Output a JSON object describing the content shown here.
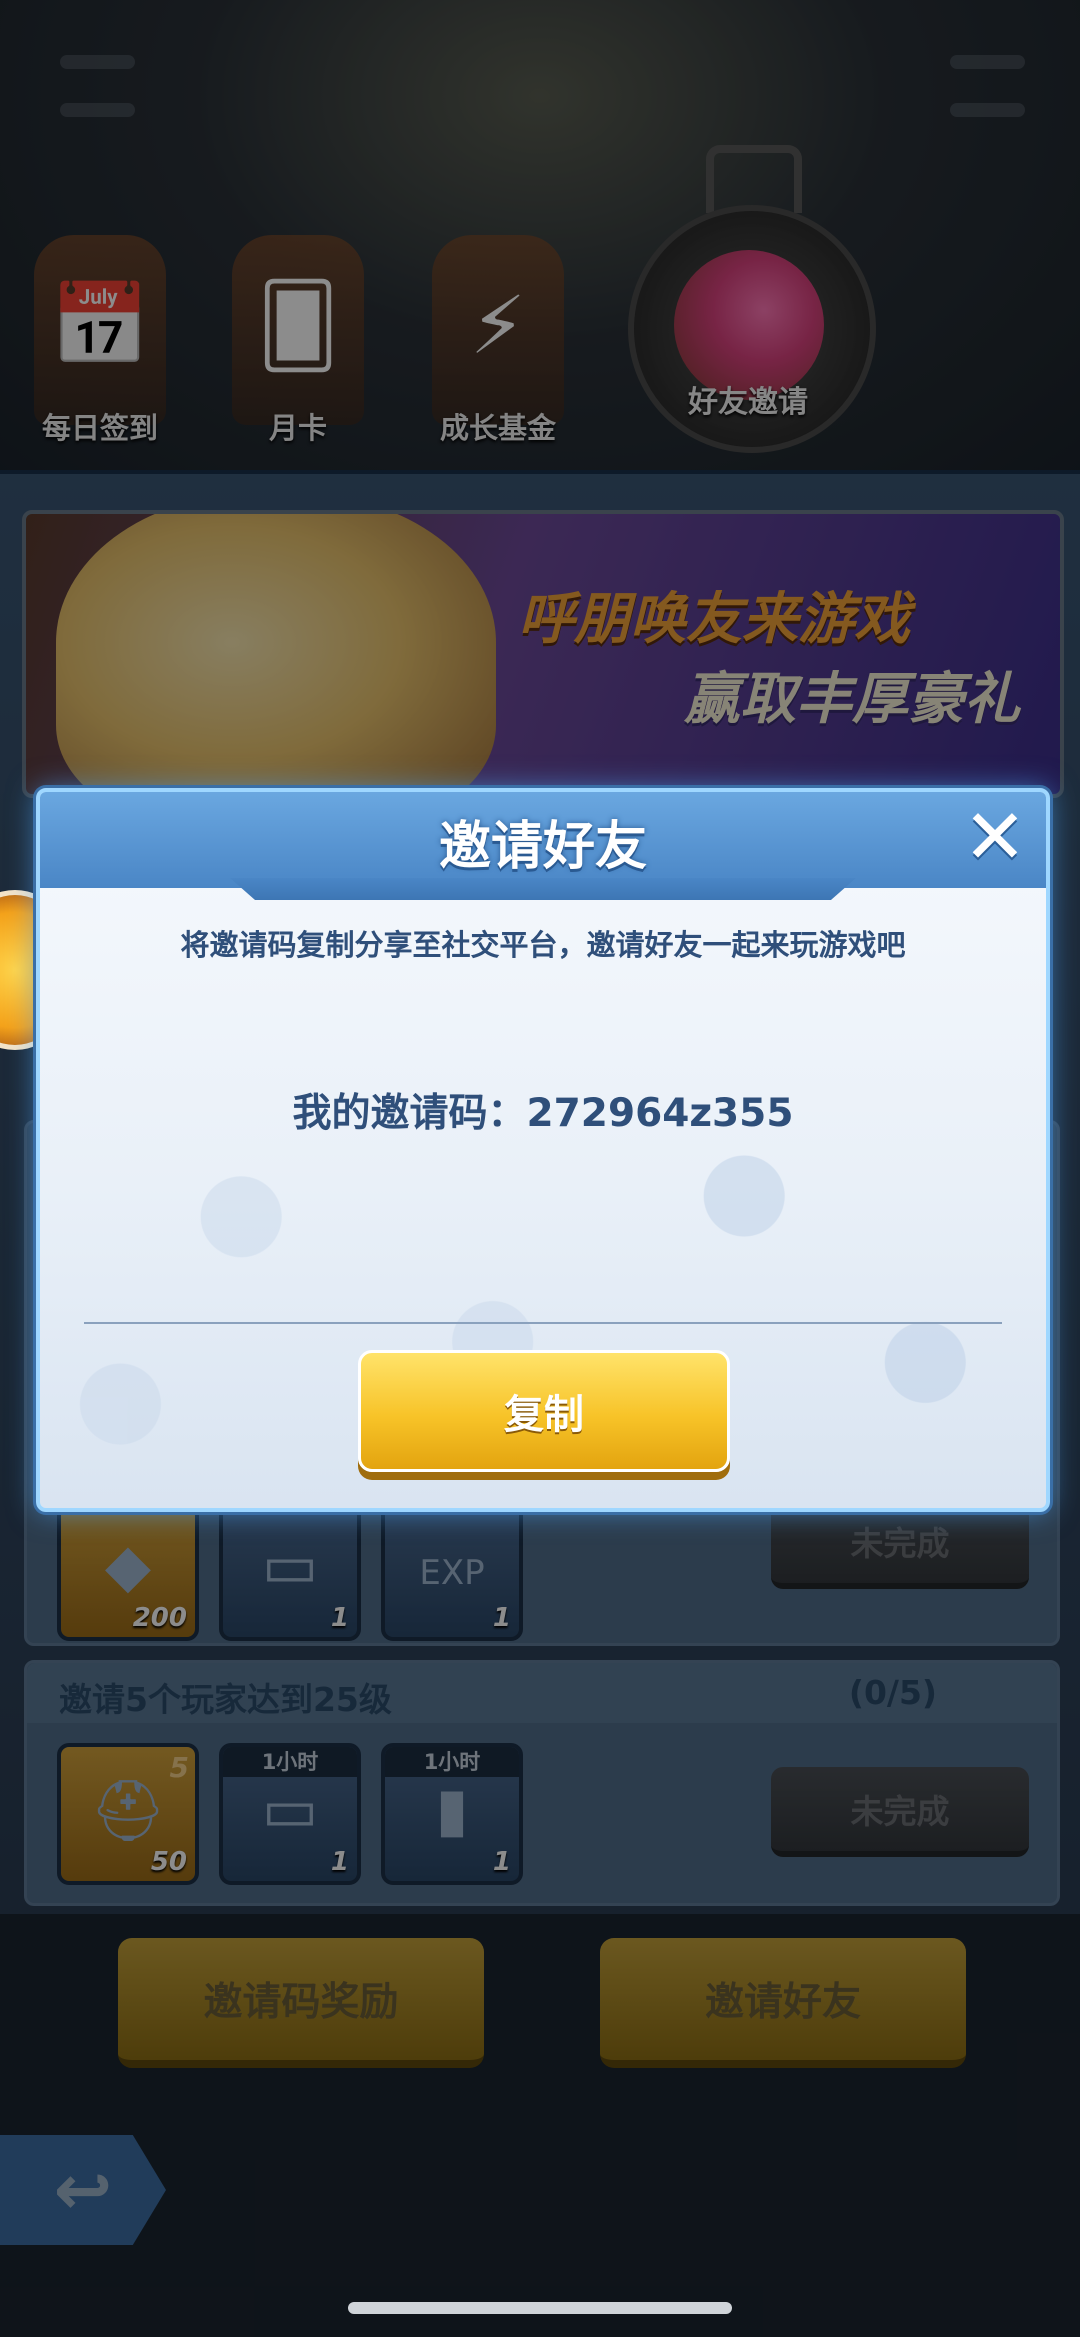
{
  "tabs": [
    {
      "label": "每日签到",
      "icon": "calendar-icon"
    },
    {
      "label": "月卡",
      "icon": "card-icon"
    },
    {
      "label": "成长基金",
      "icon": "growth-fund-icon"
    },
    {
      "label": "好友邀请",
      "icon": "friend-invite-icon"
    }
  ],
  "banner": {
    "line1": "呼朋唤友来游戏",
    "line2": "赢取丰厚豪礼"
  },
  "tasks": [
    {
      "rewards": [
        {
          "qty": "200",
          "icon": "gem-icon"
        },
        {
          "qty": "1",
          "icon": "cash-icon"
        },
        {
          "qty": "1",
          "icon": "exp-potion-icon",
          "tag": "EXP"
        }
      ],
      "status": "未完成"
    },
    {
      "title": "邀请5个玩家达到25级",
      "progress": "(0/5)",
      "rewards": [
        {
          "qty": "50",
          "level": "5",
          "icon": "helmet-icon"
        },
        {
          "qty": "1",
          "tag": "1小时",
          "icon": "cash-icon"
        },
        {
          "qty": "1",
          "tag": "1小时",
          "icon": "exp-potion-icon"
        }
      ],
      "status": "未完成"
    }
  ],
  "bottom_buttons": {
    "invite_code_reward": "邀请码奖励",
    "invite_friends": "邀请好友"
  },
  "modal": {
    "title": "邀请好友",
    "description": "将邀请码复制分享至社交平台，邀请好友一起来玩游戏吧",
    "code_line": "我的邀请码：272964z355",
    "copy_label": "复制",
    "close_icon": "close-icon"
  },
  "colors": {
    "accent_blue": "#4a86c6",
    "button_gold": "#f7c328",
    "text_blue": "#2f4f7a"
  }
}
